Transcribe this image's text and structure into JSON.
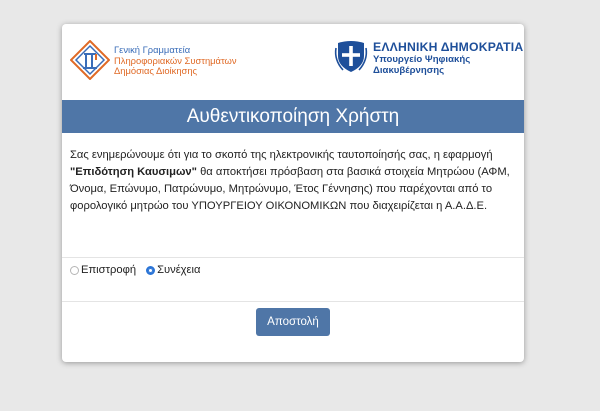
{
  "logos": {
    "ggps_line1": "Γενική Γραμματεία",
    "ggps_line2": "Πληροφοριακών Συστημάτων",
    "ggps_line3": "Δημόσιας Διοίκησης",
    "gov_title": "ΕΛΛΗΝΙΚΗ ΔΗΜΟΚΡΑΤΙΑ",
    "gov_sub1": "Υπουργείο Ψηφιακής",
    "gov_sub2": "Διακυβέρνησης"
  },
  "header": {
    "title": "Αυθεντικοποίηση Χρήστη"
  },
  "body": {
    "part1": "Σας ενημερώνουμε ότι για το σκοπό της ηλεκτρονικής ταυτοποίησής σας, η εφαρμογή ",
    "app_name": "\"Επιδότηση Καυσιμων\"",
    "part2": " θα αποκτήσει πρόσβαση στα βασικά στοιχεία Μητρώου (ΑΦΜ, Όνομα, Επώνυμο, Πατρώνυμο, Μητρώνυμο, Έτος Γέννησης) που παρέχονται από το φορολογικό μητρώο του ΥΠΟΥΡΓΕΙΟΥ ΟΙΚΟΝΟΜΙΚΩΝ που διαχειρίζεται η Α.Α.Δ.Ε."
  },
  "options": {
    "back_label": "Επιστροφή",
    "continue_label": "Συνέχεια",
    "selected": "continue"
  },
  "submit": {
    "label": "Αποστολή"
  },
  "colors": {
    "accent": "#4f76a7",
    "ggps_orange": "#e06a26",
    "gov_blue": "#1e4f9a"
  }
}
